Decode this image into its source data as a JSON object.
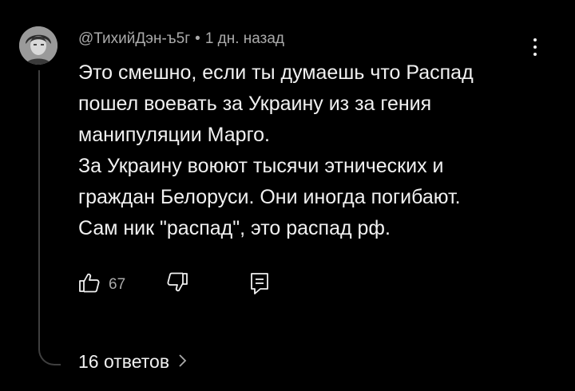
{
  "comment": {
    "author": "@ТихийДэн-ъ5г",
    "separator": "•",
    "time": "1 дн. назад",
    "text": "Это смешно, если ты думаешь что Распад\nпошел воевать за Украину из за гения\nманипуляции Марго.\nЗа Украину воюют тысячи этнических и\nграждан Белоруси. Они иногда погибают.\nСам ник \"распад\", это распад рф.",
    "like_count": "67",
    "icons": {
      "avatar": "avatar",
      "more": "more-vert-icon",
      "like": "thumb-up-icon",
      "dislike": "thumb-down-icon",
      "reply": "reply-icon",
      "expand": "chevron-right-icon"
    }
  },
  "replies": {
    "label": "16 ответов"
  },
  "colors": {
    "background": "#000000",
    "text": "#f1f1f1",
    "secondary": "#aaaaaa",
    "thread_line": "#3f3f3f"
  }
}
